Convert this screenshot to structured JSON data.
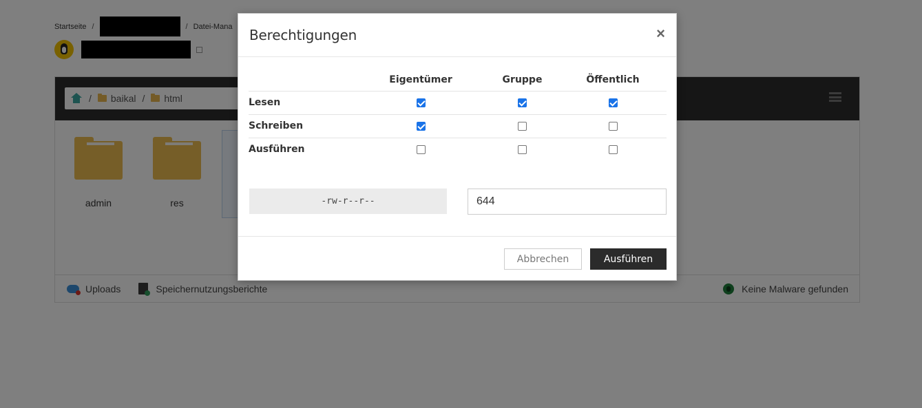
{
  "breadcrumb": {
    "home": "Startseite",
    "separator": "/",
    "current": "Datei-Mana"
  },
  "file_manager": {
    "path": {
      "separator": "/",
      "segments": [
        "baikal",
        "html"
      ]
    },
    "files": [
      {
        "name": "admin"
      },
      {
        "name": "res"
      }
    ],
    "selected_partial_label": "."
  },
  "footer": {
    "uploads": "Uploads",
    "storage_reports": "Speichernutzungsberichte",
    "malware_status": "Keine Malware gefunden"
  },
  "modal": {
    "title": "Berechtigungen",
    "close_symbol": "×",
    "columns": [
      "Eigentümer",
      "Gruppe",
      "Öffentlich"
    ],
    "rows": [
      {
        "label": "Lesen",
        "values": [
          true,
          true,
          true
        ]
      },
      {
        "label": "Schreiben",
        "values": [
          true,
          false,
          false
        ]
      },
      {
        "label": "Ausführen",
        "values": [
          false,
          false,
          false
        ]
      }
    ],
    "symbolic": "-rw-r--r--",
    "octal": "644",
    "cancel_label": "Abbrechen",
    "submit_label": "Ausführen"
  },
  "colors": {
    "overlay": "rgba(0,0,0,0.5)",
    "checkbox_checked": "#1a73e8",
    "primary_button": "#2b2b2b",
    "folder": "#ecbd51",
    "toolbar": "#2d2d2d"
  }
}
